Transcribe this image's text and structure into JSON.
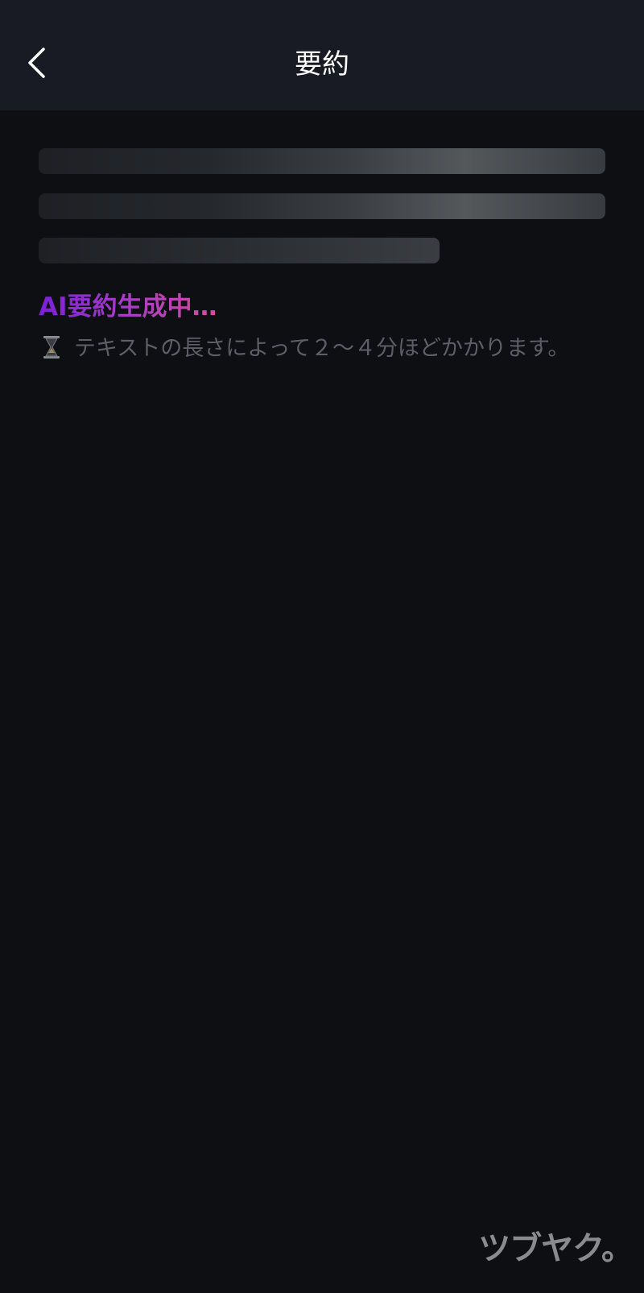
{
  "header": {
    "title": "要約",
    "back_icon": "chevron-left-icon"
  },
  "content": {
    "status_text": "AI要約生成中…",
    "hourglass_icon": "hourglass-icon",
    "note_text": "テキストの長さによって２〜４分ほどかかります。"
  },
  "watermark": {
    "text": "ツブヤク。"
  },
  "colors": {
    "header_bg": "#181b23",
    "page_bg": "#0e0f13",
    "title": "#ffffff",
    "status_gradient_start": "#7b1fd8",
    "status_gradient_end": "#d44aa2",
    "note_text": "#5d5f65"
  }
}
